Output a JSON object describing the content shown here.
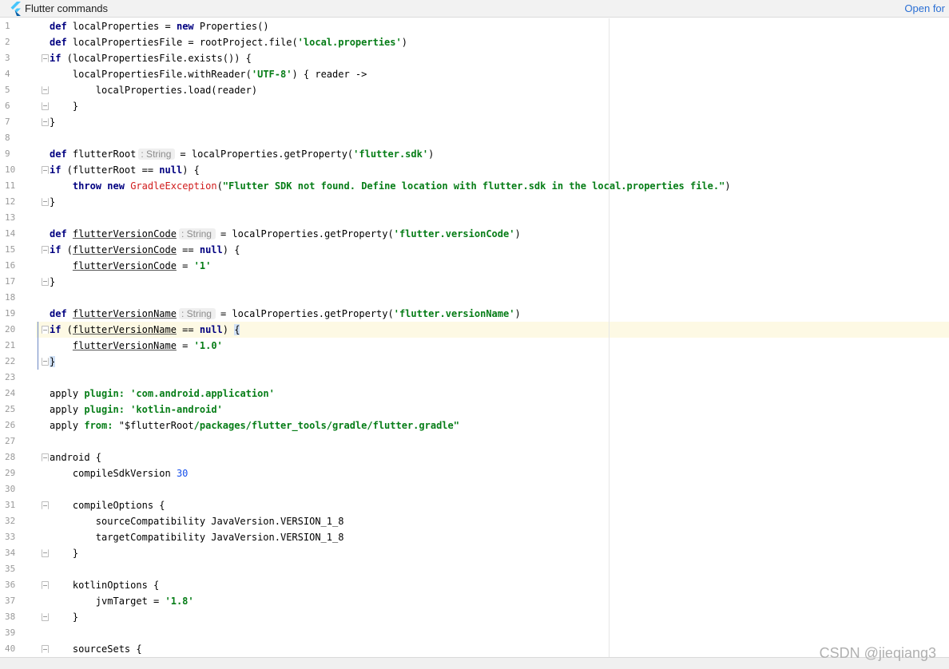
{
  "banner": {
    "title": "Flutter commands",
    "open_link": "Open for"
  },
  "editor": {
    "type_hint": ": String",
    "lines": [
      {
        "no": "1",
        "fold": "",
        "tokens": [
          {
            "t": "def",
            "c": "kw"
          },
          {
            "t": " localProperties = "
          },
          {
            "t": "new",
            "c": "kw"
          },
          {
            "t": " Properties()"
          }
        ]
      },
      {
        "no": "2",
        "fold": "",
        "tokens": [
          {
            "t": "def",
            "c": "kw"
          },
          {
            "t": " localPropertiesFile = rootProject.file("
          },
          {
            "t": "'local.properties'",
            "c": "str"
          },
          {
            "t": ")"
          }
        ]
      },
      {
        "no": "3",
        "fold": "open",
        "tokens": [
          {
            "t": "if",
            "c": "kw"
          },
          {
            "t": " (localPropertiesFile.exists()) {"
          }
        ]
      },
      {
        "no": "4",
        "fold": "",
        "tokens": [
          {
            "t": "    localPropertiesFile.withReader("
          },
          {
            "t": "'UTF-8'",
            "c": "str"
          },
          {
            "t": ") { reader ->"
          }
        ]
      },
      {
        "no": "5",
        "fold": "close",
        "tokens": [
          {
            "t": "        localProperties.load(reader)"
          }
        ]
      },
      {
        "no": "6",
        "fold": "close",
        "tokens": [
          {
            "t": "    }"
          }
        ]
      },
      {
        "no": "7",
        "fold": "close",
        "tokens": [
          {
            "t": "}"
          }
        ]
      },
      {
        "no": "8",
        "fold": "",
        "tokens": []
      },
      {
        "no": "9",
        "fold": "",
        "tokens": [
          {
            "t": "def",
            "c": "kw"
          },
          {
            "t": " flutterRoot"
          },
          {
            "hint": true
          },
          {
            "t": "= localProperties.getProperty("
          },
          {
            "t": "'flutter.sdk'",
            "c": "str"
          },
          {
            "t": ")"
          }
        ]
      },
      {
        "no": "10",
        "fold": "open",
        "tokens": [
          {
            "t": "if",
            "c": "kw"
          },
          {
            "t": " (flutterRoot == "
          },
          {
            "t": "null",
            "c": "kw"
          },
          {
            "t": ") {"
          }
        ]
      },
      {
        "no": "11",
        "fold": "",
        "tokens": [
          {
            "t": "    "
          },
          {
            "t": "throw",
            "c": "kw"
          },
          {
            "t": " "
          },
          {
            "t": "new",
            "c": "kw"
          },
          {
            "t": " "
          },
          {
            "t": "GradleException",
            "c": "cls"
          },
          {
            "t": "("
          },
          {
            "t": "\"Flutter SDK not found. Define location with flutter.sdk in the local.properties file.\"",
            "c": "str"
          },
          {
            "t": ")"
          }
        ]
      },
      {
        "no": "12",
        "fold": "close",
        "tokens": [
          {
            "t": "}"
          }
        ]
      },
      {
        "no": "13",
        "fold": "",
        "tokens": []
      },
      {
        "no": "14",
        "fold": "",
        "tokens": [
          {
            "t": "def",
            "c": "kw"
          },
          {
            "t": " "
          },
          {
            "t": "flutterVersionCode",
            "c": "ul"
          },
          {
            "hint": true
          },
          {
            "t": "= localProperties.getProperty("
          },
          {
            "t": "'flutter.versionCode'",
            "c": "str"
          },
          {
            "t": ")"
          }
        ]
      },
      {
        "no": "15",
        "fold": "open",
        "tokens": [
          {
            "t": "if",
            "c": "kw"
          },
          {
            "t": " ("
          },
          {
            "t": "flutterVersionCode",
            "c": "ul"
          },
          {
            "t": " == "
          },
          {
            "t": "null",
            "c": "kw"
          },
          {
            "t": ") {"
          }
        ]
      },
      {
        "no": "16",
        "fold": "",
        "tokens": [
          {
            "t": "    "
          },
          {
            "t": "flutterVersionCode",
            "c": "ul"
          },
          {
            "t": " = "
          },
          {
            "t": "'1'",
            "c": "str"
          }
        ]
      },
      {
        "no": "17",
        "fold": "close",
        "tokens": [
          {
            "t": "}"
          }
        ]
      },
      {
        "no": "18",
        "fold": "",
        "tokens": []
      },
      {
        "no": "19",
        "fold": "",
        "tokens": [
          {
            "t": "def",
            "c": "kw"
          },
          {
            "t": " "
          },
          {
            "t": "flutterVersionName",
            "c": "ul"
          },
          {
            "hint": true
          },
          {
            "t": "= localProperties.getProperty("
          },
          {
            "t": "'flutter.versionName'",
            "c": "str"
          },
          {
            "t": ")"
          }
        ]
      },
      {
        "no": "20",
        "fold": "open",
        "tokens": [
          {
            "t": "if",
            "c": "kw"
          },
          {
            "t": " ("
          },
          {
            "t": "flutterVersionName",
            "c": "ul"
          },
          {
            "t": " == "
          },
          {
            "t": "null",
            "c": "kw"
          },
          {
            "t": ") "
          },
          {
            "t": "{",
            "c": "brace-match"
          }
        ]
      },
      {
        "no": "21",
        "fold": "",
        "tokens": [
          {
            "t": "    "
          },
          {
            "t": "flutterVersionName",
            "c": "ul"
          },
          {
            "t": " = "
          },
          {
            "t": "'1.0'",
            "c": "str"
          }
        ]
      },
      {
        "no": "22",
        "fold": "close",
        "tokens": [
          {
            "t": "}",
            "c": "brace-match"
          }
        ]
      },
      {
        "no": "23",
        "fold": "",
        "tokens": []
      },
      {
        "no": "24",
        "fold": "",
        "tokens": [
          {
            "t": "apply "
          },
          {
            "t": "plugin:",
            "c": "str"
          },
          {
            "t": " "
          },
          {
            "t": "'com.android.application'",
            "c": "str"
          }
        ]
      },
      {
        "no": "25",
        "fold": "",
        "tokens": [
          {
            "t": "apply "
          },
          {
            "t": "plugin:",
            "c": "str"
          },
          {
            "t": " "
          },
          {
            "t": "'kotlin-android'",
            "c": "str"
          }
        ]
      },
      {
        "no": "26",
        "fold": "",
        "tokens": [
          {
            "t": "apply "
          },
          {
            "t": "from:",
            "c": "str"
          },
          {
            "t": " \"$flutterRoot"
          },
          {
            "t": "/packages/flutter_tools/gradle/flutter.gradle\"",
            "c": "str"
          }
        ]
      },
      {
        "no": "27",
        "fold": "",
        "tokens": []
      },
      {
        "no": "28",
        "fold": "open",
        "tokens": [
          {
            "t": "android {"
          }
        ]
      },
      {
        "no": "29",
        "fold": "",
        "tokens": [
          {
            "t": "    compileSdkVersion "
          },
          {
            "t": "30",
            "c": "num"
          }
        ]
      },
      {
        "no": "30",
        "fold": "",
        "tokens": []
      },
      {
        "no": "31",
        "fold": "open",
        "tokens": [
          {
            "t": "    compileOptions {"
          }
        ]
      },
      {
        "no": "32",
        "fold": "",
        "tokens": [
          {
            "t": "        sourceCompatibility JavaVersion.VERSION_1_8"
          }
        ]
      },
      {
        "no": "33",
        "fold": "",
        "tokens": [
          {
            "t": "        targetCompatibility JavaVersion.VERSION_1_8"
          }
        ]
      },
      {
        "no": "34",
        "fold": "close",
        "tokens": [
          {
            "t": "    }"
          }
        ]
      },
      {
        "no": "35",
        "fold": "",
        "tokens": []
      },
      {
        "no": "36",
        "fold": "open",
        "tokens": [
          {
            "t": "    kotlinOptions {"
          }
        ]
      },
      {
        "no": "37",
        "fold": "",
        "tokens": [
          {
            "t": "        jvmTarget = "
          },
          {
            "t": "'1.8'",
            "c": "str"
          }
        ]
      },
      {
        "no": "38",
        "fold": "close",
        "tokens": [
          {
            "t": "    }"
          }
        ]
      },
      {
        "no": "39",
        "fold": "",
        "tokens": []
      },
      {
        "no": "40",
        "fold": "open",
        "tokens": [
          {
            "t": "    sourceSets {"
          }
        ]
      }
    ]
  },
  "watermark": "CSDN @jieqiang3"
}
